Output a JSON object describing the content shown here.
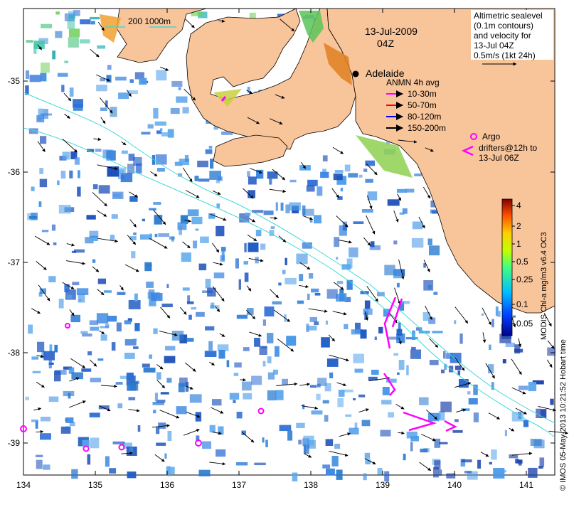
{
  "map": {
    "date": "13-Jul-2009",
    "time": "04Z",
    "city": "Adelaide",
    "bathy_legend": "200  1000m",
    "sealevel_title": [
      "Altimetric sealevel",
      "(0.1m contours)",
      "and velocity for",
      "13-Jul 04Z",
      "0.5m/s (1kt 24h)"
    ],
    "anmn": {
      "title": "ANMN 4h avg",
      "items": [
        {
          "label": "10-30m",
          "color": "#ff00ff"
        },
        {
          "label": "50-70m",
          "color": "#ff0000"
        },
        {
          "label": "80-120m",
          "color": "#0000ff"
        },
        {
          "label": "150-200m",
          "color": "#000000"
        }
      ]
    },
    "argo": {
      "label": "Argo",
      "color": "#ff00ff"
    },
    "drifters": {
      "label": [
        "drifters@12h to",
        "13-Jul 06Z"
      ],
      "color": "#ff00ff"
    },
    "colorbar": {
      "title": "MODIS Chl-a mg/m3 v6.4 OC3",
      "ticks": [
        "4",
        "2",
        "1",
        "0.5",
        "0.25",
        "0.1",
        "0.05"
      ],
      "scale": "log"
    },
    "credit": "© IMOS 05-May-2013 10:21:52 Hobart time",
    "axes": {
      "lon_ticks": [
        "134",
        "135",
        "136",
        "137",
        "138",
        "139",
        "140",
        "141"
      ],
      "lat_ticks": [
        "-35",
        "-36",
        "-37",
        "-38",
        "-39"
      ],
      "lon_range": [
        134,
        141.35
      ],
      "lat_range": [
        -39.55,
        -34.3
      ]
    },
    "colors": {
      "land": "#f8c49a",
      "chl_low": "#3a7cd8",
      "chl_high": "#e07020",
      "bathy": "#40d8d8",
      "arrow": "#000000"
    }
  }
}
